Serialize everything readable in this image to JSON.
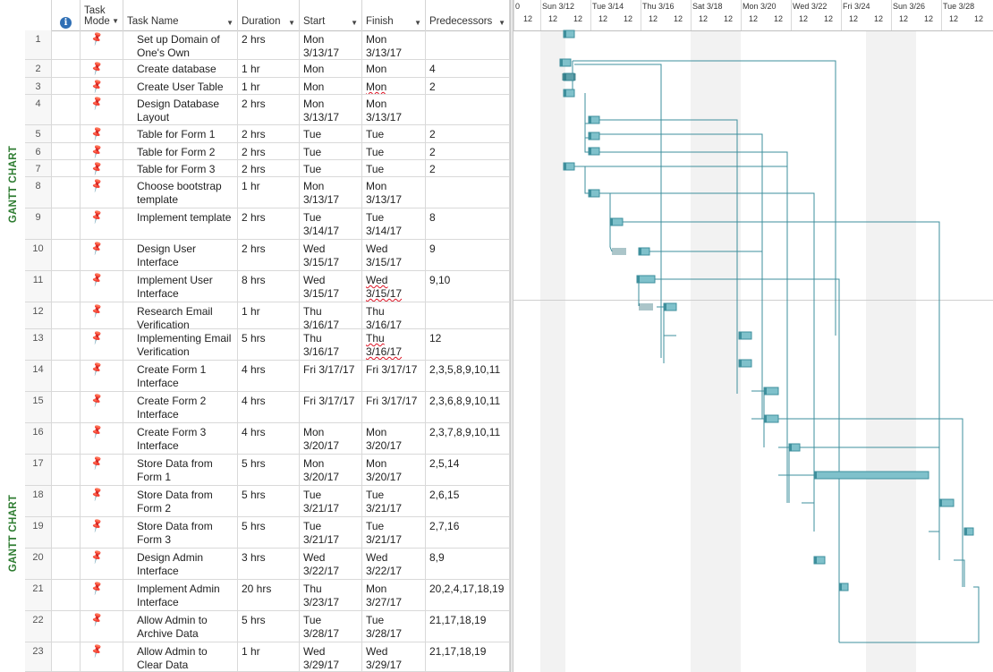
{
  "side_labels": [
    "GANTT CHART",
    "GANTT CHART"
  ],
  "columns": {
    "info_icon": "info-icon",
    "task_mode": "Task Mode",
    "task_name": "Task Name",
    "duration": "Duration",
    "start": "Start",
    "finish": "Finish",
    "predecessors": "Predecessors"
  },
  "tasks": [
    {
      "id": "1",
      "name": "Set up Domain of One's Own",
      "duration": "2 hrs",
      "start": "Mon 3/13/17",
      "finish": "Mon 3/13/17",
      "pred": ""
    },
    {
      "id": "2",
      "name": "Create database",
      "duration": "1 hr",
      "start": "Mon 3/13/17",
      "finish": "Mon 3/13/17",
      "pred": "4"
    },
    {
      "id": "3",
      "name": "Create User Table",
      "duration": "1 hr",
      "start": "Mon 3/13/17",
      "finish": "Mon 3/13/17",
      "pred": "2"
    },
    {
      "id": "4",
      "name": "Design Database Layout",
      "duration": "2 hrs",
      "start": "Mon 3/13/17",
      "finish": "Mon 3/13/17",
      "pred": ""
    },
    {
      "id": "5",
      "name": "Table for Form 1",
      "duration": "2 hrs",
      "start": "Tue 3/14/17",
      "finish": "Tue 3/14/17",
      "pred": "2"
    },
    {
      "id": "6",
      "name": "Table for Form 2",
      "duration": "2 hrs",
      "start": "Tue 3/14/17",
      "finish": "Tue 3/14/17",
      "pred": "2"
    },
    {
      "id": "7",
      "name": "Table for Form 3",
      "duration": "2 hrs",
      "start": "Tue 3/14/17",
      "finish": "Tue 3/14/17",
      "pred": "2"
    },
    {
      "id": "8",
      "name": "Choose bootstrap template",
      "duration": "1 hr",
      "start": "Mon 3/13/17",
      "finish": "Mon 3/13/17",
      "pred": ""
    },
    {
      "id": "9",
      "name": "Implement template",
      "duration": "2 hrs",
      "start": "Tue 3/14/17",
      "finish": "Tue 3/14/17",
      "pred": "8"
    },
    {
      "id": "10",
      "name": "Design User Interface",
      "duration": "2 hrs",
      "start": "Wed 3/15/17",
      "finish": "Wed 3/15/17",
      "pred": "9"
    },
    {
      "id": "11",
      "name": "Implement User Interface",
      "duration": "8 hrs",
      "start": "Wed 3/15/17",
      "finish": "Wed 3/15/17",
      "pred": "9,10"
    },
    {
      "id": "12",
      "name": "Research Email Verification",
      "duration": "1 hr",
      "start": "Thu 3/16/17",
      "finish": "Thu 3/16/17",
      "pred": ""
    },
    {
      "id": "13",
      "name": "Implementing Email Verification",
      "duration": "5 hrs",
      "start": "Thu 3/16/17",
      "finish": "Thu 3/16/17",
      "pred": "12"
    },
    {
      "id": "14",
      "name": "Create Form 1 Interface",
      "duration": "4 hrs",
      "start": "Fri 3/17/17",
      "finish": "Fri 3/17/17",
      "pred": "2,3,5,8,9,10,11"
    },
    {
      "id": "15",
      "name": "Create Form 2 Interface",
      "duration": "4 hrs",
      "start": "Fri 3/17/17",
      "finish": "Fri 3/17/17",
      "pred": "2,3,6,8,9,10,11"
    },
    {
      "id": "16",
      "name": "Create Form 3 Interface",
      "duration": "4 hrs",
      "start": "Mon 3/20/17",
      "finish": "Mon 3/20/17",
      "pred": "2,3,7,8,9,10,11"
    },
    {
      "id": "17",
      "name": "Store Data from Form 1",
      "duration": "5 hrs",
      "start": "Mon 3/20/17",
      "finish": "Mon 3/20/17",
      "pred": "2,5,14"
    },
    {
      "id": "18",
      "name": "Store Data from Form 2",
      "duration": "5 hrs",
      "start": "Tue 3/21/17",
      "finish": "Tue 3/21/17",
      "pred": "2,6,15"
    },
    {
      "id": "19",
      "name": "Store Data from Form 3",
      "duration": "5 hrs",
      "start": "Tue 3/21/17",
      "finish": "Tue 3/21/17",
      "pred": "2,7,16"
    },
    {
      "id": "20",
      "name": "Design Admin Interface",
      "duration": "3 hrs",
      "start": "Wed 3/22/17",
      "finish": "Wed 3/22/17",
      "pred": "8,9"
    },
    {
      "id": "21",
      "name": "Implement Admin Interface",
      "duration": "20 hrs",
      "start": "Thu 3/23/17",
      "finish": "Mon 3/27/17",
      "pred": "20,2,4,17,18,19"
    },
    {
      "id": "22",
      "name": "Allow Admin to Archive Data",
      "duration": "5 hrs",
      "start": "Tue 3/28/17",
      "finish": "Tue 3/28/17",
      "pred": "21,17,18,19"
    },
    {
      "id": "23",
      "name": "Allow Admin to Clear Data",
      "duration": "1 hr",
      "start": "Wed 3/29/17",
      "finish": "Wed 3/29/17",
      "pred": "21,17,18,19"
    }
  ],
  "timescale": {
    "days": [
      "0",
      "Sun 3/12",
      "Tue 3/14",
      "Thu 3/16",
      "Sat 3/18",
      "Mon 3/20",
      "Wed 3/22",
      "Fri 3/24",
      "Sun 3/26",
      "Tue 3/28"
    ],
    "tick_label": "12"
  },
  "colors": {
    "bar": "#7fc1cb",
    "bar_border": "#3e8f9c",
    "link": "#3e8f9c",
    "side_label": "#2f7d32",
    "weekend": "#f2f2f2"
  }
}
